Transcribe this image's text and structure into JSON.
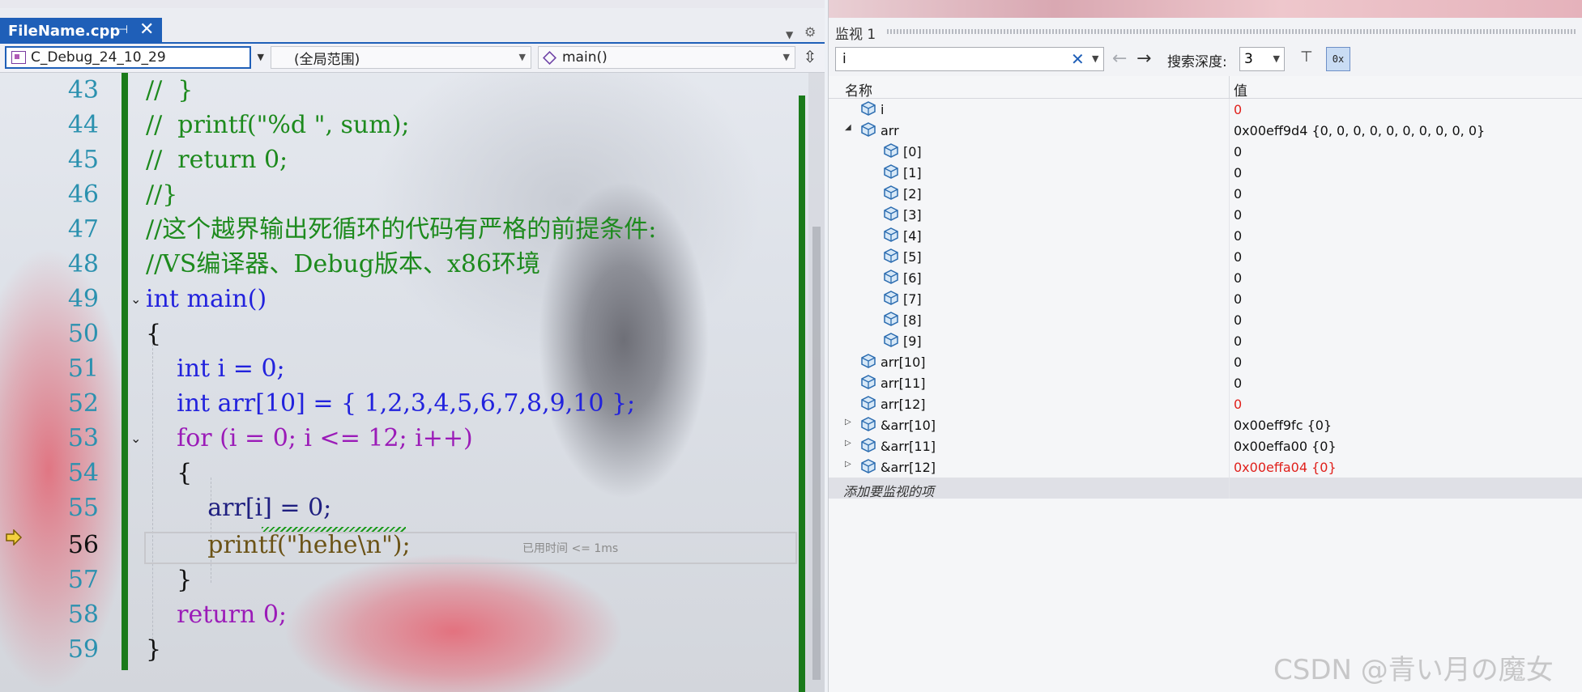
{
  "editor": {
    "tab": {
      "filename": "FileName.cpp",
      "pin": "⊣",
      "close": "✕"
    },
    "nav": {
      "project": "C_Debug_24_10_29",
      "scope": "(全局范围)",
      "function": "main()"
    },
    "lines": [
      {
        "num": "43",
        "text": "//  }"
      },
      {
        "num": "44",
        "text": "//  printf(\"%d \", sum);"
      },
      {
        "num": "45",
        "text": "//  return 0;"
      },
      {
        "num": "46",
        "text": "//}"
      },
      {
        "num": "47",
        "text": "//这个越界输出死循环的代码有严格的前提条件:"
      },
      {
        "num": "48",
        "text": "//VS编译器、Debug版本、x86环境"
      },
      {
        "num": "49",
        "text": "int main()"
      },
      {
        "num": "50",
        "text": "{"
      },
      {
        "num": "51",
        "text": "    int i = 0;"
      },
      {
        "num": "52",
        "text": "    int arr[10] = { 1,2,3,4,5,6,7,8,9,10 };"
      },
      {
        "num": "53",
        "text": "    for (i = 0; i <= 12; i++)"
      },
      {
        "num": "54",
        "text": "    {"
      },
      {
        "num": "55",
        "text": "        arr[i] = 0;"
      },
      {
        "num": "56",
        "text": "        printf(\"hehe\\n\");"
      },
      {
        "num": "57",
        "text": "    }"
      },
      {
        "num": "58",
        "text": "    return 0;"
      },
      {
        "num": "59",
        "text": "}"
      }
    ],
    "timing": "已用时间 <= 1ms",
    "current_line": "56"
  },
  "watch": {
    "title": "监视 1",
    "search_value": "i",
    "depth_label": "搜索深度:",
    "depth_value": "3",
    "hex_label": "0x",
    "columns": {
      "name": "名称",
      "value": "值"
    },
    "rows": [
      {
        "name": "i",
        "value": "0",
        "indent": 0,
        "expander": "",
        "red": true
      },
      {
        "name": "arr",
        "value": "0x00eff9d4 {0, 0, 0, 0, 0, 0, 0, 0, 0, 0}",
        "indent": 0,
        "expander": "◢",
        "red": false
      },
      {
        "name": "[0]",
        "value": "0",
        "indent": 1,
        "expander": "",
        "red": false
      },
      {
        "name": "[1]",
        "value": "0",
        "indent": 1,
        "expander": "",
        "red": false
      },
      {
        "name": "[2]",
        "value": "0",
        "indent": 1,
        "expander": "",
        "red": false
      },
      {
        "name": "[3]",
        "value": "0",
        "indent": 1,
        "expander": "",
        "red": false
      },
      {
        "name": "[4]",
        "value": "0",
        "indent": 1,
        "expander": "",
        "red": false
      },
      {
        "name": "[5]",
        "value": "0",
        "indent": 1,
        "expander": "",
        "red": false
      },
      {
        "name": "[6]",
        "value": "0",
        "indent": 1,
        "expander": "",
        "red": false
      },
      {
        "name": "[7]",
        "value": "0",
        "indent": 1,
        "expander": "",
        "red": false
      },
      {
        "name": "[8]",
        "value": "0",
        "indent": 1,
        "expander": "",
        "red": false
      },
      {
        "name": "[9]",
        "value": "0",
        "indent": 1,
        "expander": "",
        "red": false
      },
      {
        "name": "arr[10]",
        "value": "0",
        "indent": 0,
        "expander": "",
        "red": false
      },
      {
        "name": "arr[11]",
        "value": "0",
        "indent": 0,
        "expander": "",
        "red": false
      },
      {
        "name": "arr[12]",
        "value": "0",
        "indent": 0,
        "expander": "",
        "red": true
      },
      {
        "name": "&arr[10]",
        "value": "0x00eff9fc {0}",
        "indent": 0,
        "expander": "▷",
        "red": false
      },
      {
        "name": "&arr[11]",
        "value": "0x00effa00 {0}",
        "indent": 0,
        "expander": "▷",
        "red": false
      },
      {
        "name": "&arr[12]",
        "value": "0x00effa04 {0}",
        "indent": 0,
        "expander": "▷",
        "red": true
      }
    ],
    "add_item": "添加要监视的项"
  },
  "watermark": "CSDN @青い月の魔女",
  "colors": {
    "accent": "#1f5fb8",
    "comment": "#1d8a1d",
    "keyword": "#2222dd",
    "error_value": "#e0201b",
    "change_bar": "#1a7a1a"
  }
}
